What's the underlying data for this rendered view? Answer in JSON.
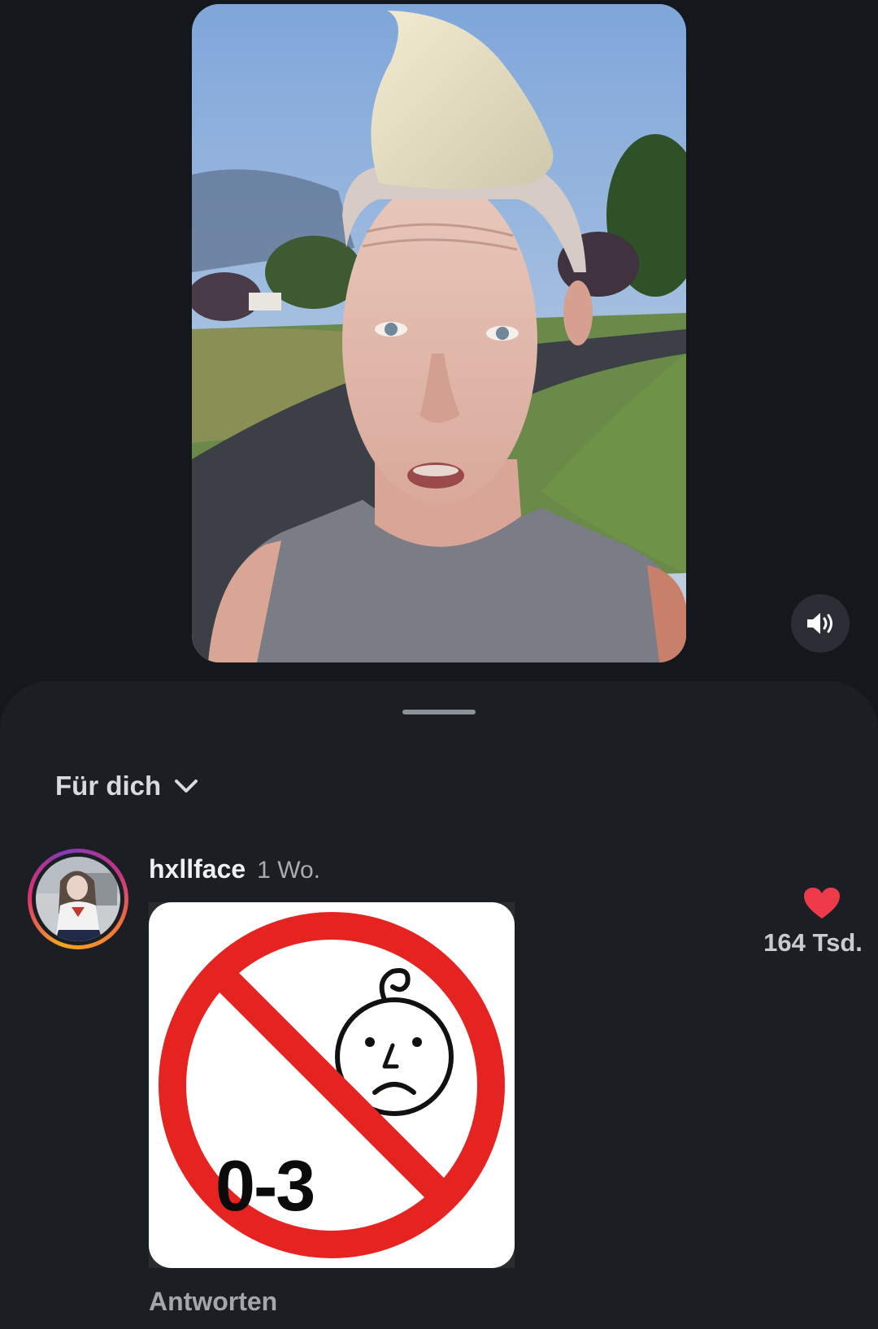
{
  "video": {
    "description_icon": "video-frame",
    "sound_icon": "speaker-on-icon"
  },
  "comments_sheet": {
    "sort_label": "Für dich",
    "sort_icon": "chevron-down-icon"
  },
  "comment": {
    "username": "hxllface",
    "time": "1 Wo.",
    "sticker_text": "0-3",
    "reply_label": "Antworten",
    "like_count": "164 Tsd.",
    "like_icon": "heart-icon",
    "like_color": "#ed3b4b"
  }
}
